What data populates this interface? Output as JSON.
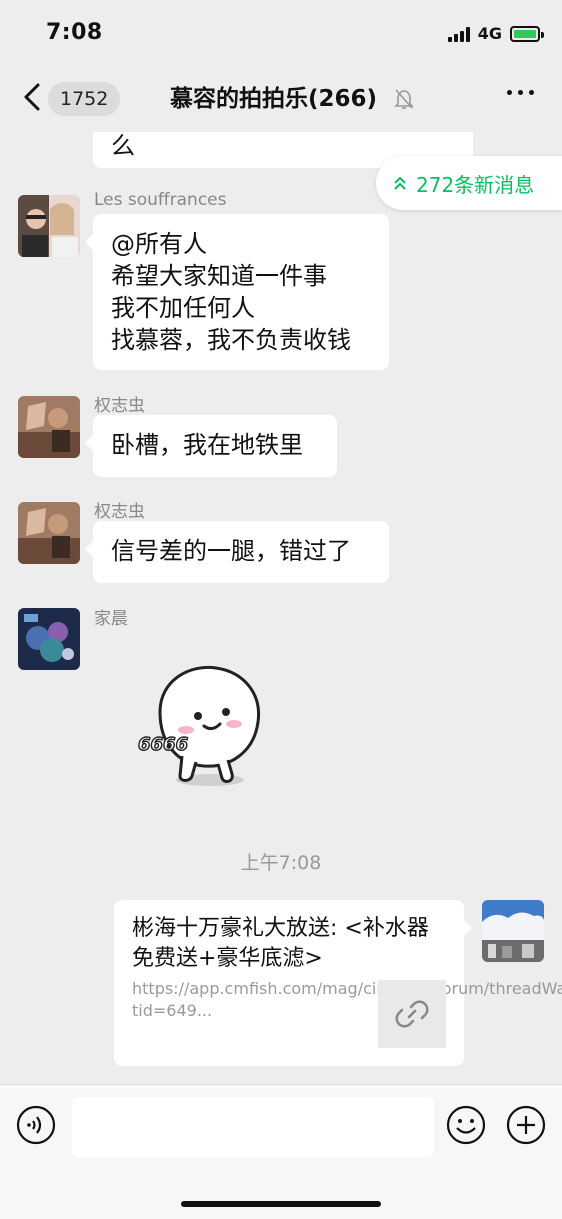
{
  "status_bar": {
    "time": "7:08",
    "network": "4G"
  },
  "nav": {
    "back_count": "1752",
    "title": "慕容的拍拍乐(266)"
  },
  "new_messages": {
    "label": "272条新消息"
  },
  "messages": [
    {
      "type": "text",
      "side": "left",
      "text": "么"
    },
    {
      "type": "text",
      "side": "left",
      "sender": "Les souffrances",
      "lines": [
        "@所有人",
        "希望大家知道一件事",
        "我不加任何人",
        "找慕蓉，我不负责收钱"
      ]
    },
    {
      "type": "text",
      "side": "left",
      "sender": "权志虫",
      "text": "卧槽，我在地铁里"
    },
    {
      "type": "text",
      "side": "left",
      "sender": "权志虫",
      "text": "信号差的一腿，错过了"
    },
    {
      "type": "sticker",
      "side": "left",
      "sender": "家晨",
      "sticker_text": "6666"
    }
  ],
  "timestamp": "上午7:08",
  "link_card": {
    "title": "彬海十万豪礼大放送: <补水器免费送+豪华底滤>",
    "url": "https://app.cmfish.com/mag/circle/v1/forum/threadWapPage?tid=649..."
  },
  "colors": {
    "accent": "#07c160",
    "bubble": "#ffffff",
    "background": "#ededed"
  }
}
